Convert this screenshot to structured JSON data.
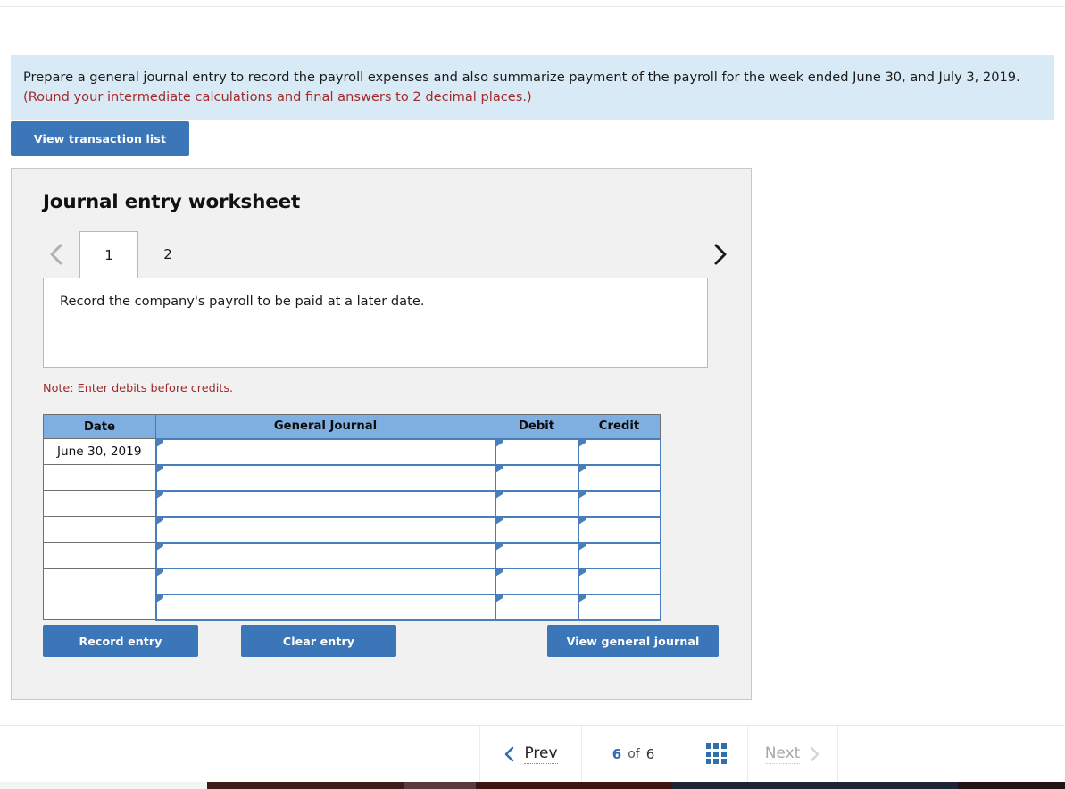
{
  "banner": {
    "text_main": "Prepare a general journal entry to record the payroll expenses and also summarize payment of the payroll for the week ended June 30, and July 3, 2019. ",
    "text_hint": "(Round your intermediate calculations and final answers to 2 decimal places.)"
  },
  "toolbar": {
    "view_transaction_list": "View transaction list"
  },
  "worksheet": {
    "title": "Journal entry worksheet",
    "tabs": [
      {
        "label": "1",
        "active": true
      },
      {
        "label": "2",
        "active": false
      }
    ],
    "prev_arrow_icon": "chevron-left-icon",
    "next_arrow_icon": "chevron-right-icon",
    "description": "Record the company's payroll to be paid at a later date.",
    "note": "Note: Enter debits before credits."
  },
  "table": {
    "headers": [
      "Date",
      "General Journal",
      "Debit",
      "Credit"
    ],
    "rows": [
      {
        "date": "June 30, 2019",
        "general_journal": "",
        "debit": "",
        "credit": ""
      },
      {
        "date": "",
        "general_journal": "",
        "debit": "",
        "credit": ""
      },
      {
        "date": "",
        "general_journal": "",
        "debit": "",
        "credit": ""
      },
      {
        "date": "",
        "general_journal": "",
        "debit": "",
        "credit": ""
      },
      {
        "date": "",
        "general_journal": "",
        "debit": "",
        "credit": ""
      },
      {
        "date": "",
        "general_journal": "",
        "debit": "",
        "credit": ""
      },
      {
        "date": "",
        "general_journal": "",
        "debit": "",
        "credit": ""
      }
    ]
  },
  "actions": {
    "record_entry": "Record entry",
    "clear_entry": "Clear entry",
    "view_general_journal": "View general journal"
  },
  "footer_nav": {
    "prev_label": "Prev",
    "next_label": "Next",
    "current_page": "6",
    "of_label": "of",
    "total_pages": "6",
    "grid_icon": "grid-view-icon",
    "prev_icon": "chevron-left-icon",
    "next_icon": "chevron-right-icon"
  },
  "colors": {
    "banner_bg": "#d9eaf7",
    "accent_blue": "#3b76b8",
    "table_header_blue": "#7faee0",
    "input_border_blue": "#4a7ebb",
    "hint_red": "#a52a2a",
    "note_red": "#9e2a2b",
    "nav_active_blue": "#2f6fb0"
  }
}
